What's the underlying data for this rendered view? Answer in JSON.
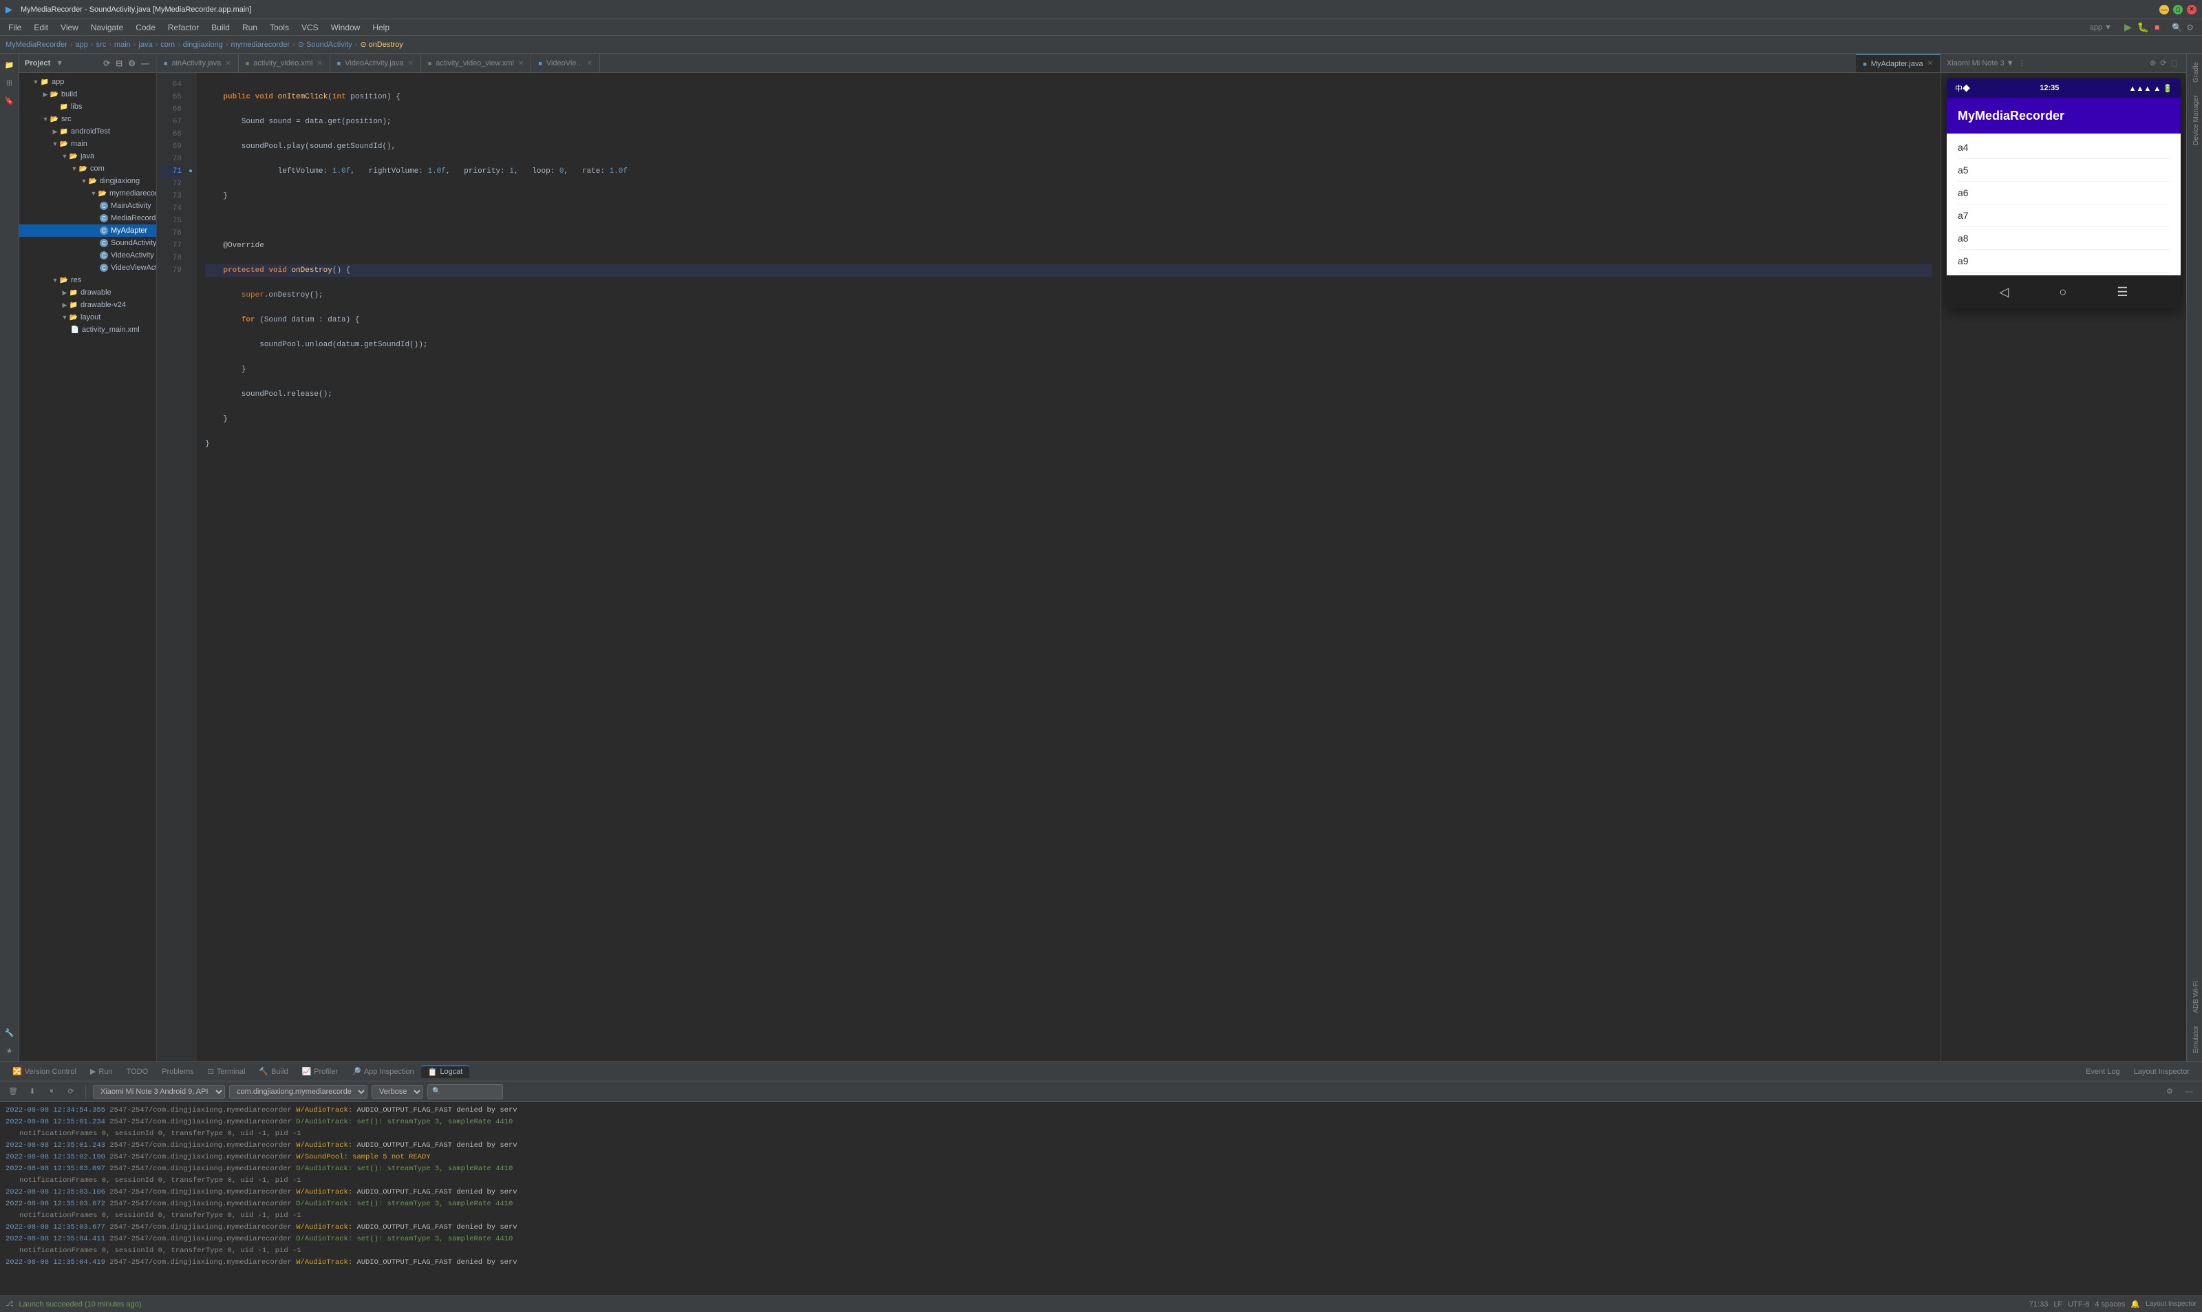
{
  "window": {
    "title": "MyMediaRecorder - SoundActivity.java [MyMediaRecorder.app.main]",
    "minimize_label": "—",
    "maximize_label": "□",
    "close_label": "✕"
  },
  "menu": {
    "items": [
      "File",
      "Edit",
      "View",
      "Navigate",
      "Code",
      "Refactor",
      "Build",
      "Run",
      "Tools",
      "VCS",
      "Window",
      "Help"
    ]
  },
  "breadcrumb": {
    "items": [
      "MyMediaRecorder",
      "app",
      "src",
      "main",
      "java",
      "com",
      "dingjiaxiong",
      "mymediarecorder",
      "SoundActivity",
      "onDestroy"
    ]
  },
  "project_panel": {
    "title": "Project",
    "tree": [
      {
        "label": "app",
        "type": "folder",
        "level": 0,
        "expanded": true
      },
      {
        "label": "build",
        "type": "folder",
        "level": 1,
        "expanded": true
      },
      {
        "label": "libs",
        "type": "folder",
        "level": 2
      },
      {
        "label": "src",
        "type": "folder",
        "level": 1,
        "expanded": true
      },
      {
        "label": "androidTest",
        "type": "folder",
        "level": 2
      },
      {
        "label": "main",
        "type": "folder",
        "level": 2,
        "expanded": true
      },
      {
        "label": "java",
        "type": "folder",
        "level": 3,
        "expanded": true
      },
      {
        "label": "com",
        "type": "folder",
        "level": 4,
        "expanded": true
      },
      {
        "label": "dingjiaxiong",
        "type": "folder",
        "level": 5,
        "expanded": true
      },
      {
        "label": "mymediarecorder",
        "type": "folder",
        "level": 6,
        "expanded": true
      },
      {
        "label": "MainActivity",
        "type": "java",
        "level": 7
      },
      {
        "label": "MediaRecordActivity",
        "type": "java",
        "level": 7
      },
      {
        "label": "MyAdapter",
        "type": "java",
        "level": 7,
        "selected": true
      },
      {
        "label": "SoundActivity",
        "type": "java",
        "level": 7
      },
      {
        "label": "VideoActivity",
        "type": "java",
        "level": 7
      },
      {
        "label": "VideoViewActivity",
        "type": "java",
        "level": 7
      },
      {
        "label": "res",
        "type": "folder",
        "level": 2,
        "expanded": true
      },
      {
        "label": "drawable",
        "type": "folder",
        "level": 3
      },
      {
        "label": "drawable-v24",
        "type": "folder",
        "level": 3
      },
      {
        "label": "layout",
        "type": "folder",
        "level": 3,
        "expanded": true
      },
      {
        "label": "activity_main.xml",
        "type": "xml",
        "level": 4
      }
    ]
  },
  "editor": {
    "tabs": [
      {
        "label": "ainActivity.java",
        "active": false
      },
      {
        "label": "activity_video.xml",
        "active": false
      },
      {
        "label": "VideoActivity.java",
        "active": false
      },
      {
        "label": "activity_video_view.xml",
        "active": false
      },
      {
        "label": "VideoVie...",
        "active": false
      }
    ],
    "right_tab": "MyAdapter.java",
    "lines": [
      {
        "num": 64,
        "content": "    <span class='kw'>public</span> <span class='kw'>void</span> <span class='method-name'>onItemClick</span>(<span class='kw'>int</span> position) {"
      },
      {
        "num": 65,
        "content": "        Sound sound = data.get(position);"
      },
      {
        "num": 66,
        "content": "        soundPool.play(sound.getSoundId(),"
      },
      {
        "num": 67,
        "content": "                leftVolume: <span class='number'>1.0f</span>,   rightVolume: <span class='number'>1.0f</span>,   priority: <span class='number'>1</span>,   loop: <span class='number'>0</span>,   rate: <span class='number'>1.0f</span>"
      },
      {
        "num": 68,
        "content": "    }"
      },
      {
        "num": 69,
        "content": ""
      },
      {
        "num": 70,
        "content": "    <span class='annotation'>@Override</span>"
      },
      {
        "num": 71,
        "content": "    <span class='kw'>protected</span> <span class='kw'>void</span> <span class='method-name'>onDestroy</span>() {"
      },
      {
        "num": 72,
        "content": "        super.onDestroy();"
      },
      {
        "num": 73,
        "content": "        <span class='kw'>for</span> (Sound datum : data) {"
      },
      {
        "num": 74,
        "content": "            soundPool.unload(datum.getSoundId());"
      },
      {
        "num": 75,
        "content": "        }"
      },
      {
        "num": 76,
        "content": "        soundPool.release();"
      },
      {
        "num": 77,
        "content": "    }"
      },
      {
        "num": 78,
        "content": "}"
      },
      {
        "num": 79,
        "content": ""
      }
    ]
  },
  "device": {
    "time": "12:35",
    "signal": "●●● ▲ WiFi 🔋",
    "app_title": "MyMediaRecorder",
    "list_items": [
      "a4",
      "a5",
      "a6",
      "a7",
      "a8",
      "a9"
    ]
  },
  "logcat": {
    "device": "Xiaomi Mi Note 3  Android 9, API",
    "package": "com.dingjiaxiong.mymediarecorde",
    "level": "Verbose",
    "logs": [
      {
        "type": "warn",
        "text": "2022-08-08  12:34:54.355  2547-2547/com.dingjiaxiong.mymediarecorder  W/AudioTrack:  AUDIO_OUTPUT_FLAG_FAST denied by serv"
      },
      {
        "type": "debug",
        "text": "2022-08-08  12:35:01.234  2547-2547/com.dingjiaxiong.mymediarecorder  D/AudioTrack:  set(): streamType 3, sampleRate 4410"
      },
      {
        "type": "continued",
        "text": "    notificationFrames 0, sessionId 0, transferType 0, uid -1, pid -1"
      },
      {
        "type": "warn",
        "text": "2022-08-08  12:35:01.243  2547-2547/com.dingjiaxiong.mymediarecorder  W/AudioTrack:  AUDIO_OUTPUT_FLAG_FAST denied by serv"
      },
      {
        "type": "warn",
        "text": "2022-08-08  12:35:02.190  2547-2547/com.dingjiaxiong.mymediarecorder  W/SoundPool:   sample 5 not READY"
      },
      {
        "type": "debug",
        "text": "2022-08-08  12:35:03.097  2547-2547/com.dingjiaxiong.mymediarecorder  D/AudioTrack:  set(): streamType 3, sampleRate 4410"
      },
      {
        "type": "continued",
        "text": "    notificationFrames 0, sessionId 0, transferType 0, uid -1, pid -1"
      },
      {
        "type": "warn",
        "text": "2022-08-08  12:35:03.106  2547-2547/com.dingjiaxiong.mymediarecorder  W/AudioTrack:  AUDIO_OUTPUT_FLAG_FAST denied by serv"
      },
      {
        "type": "debug",
        "text": "2022-08-08  12:35:03.672  2547-2547/com.dingjiaxiong.mymediarecorder  D/AudioTrack:  set(): streamType 3, sampleRate 4410"
      },
      {
        "type": "continued",
        "text": "    notificationFrames 0, sessionId 0, transferType 0, uid -1, pid -1"
      },
      {
        "type": "warn",
        "text": "2022-08-08  12:35:03.677  2547-2547/com.dingjiaxiong.mymediarecorder  W/AudioTrack:  AUDIO_OUTPUT_FLAG_FAST denied by serv"
      },
      {
        "type": "debug",
        "text": "2022-08-08  12:35:04.411  2547-2547/com.dingjiaxiong.mymediarecorder  D/AudioTrack:  set(): streamType 3, sampleRate 4410"
      },
      {
        "type": "continued",
        "text": "    notificationFrames 0, sessionId 0, transferType 0, uid -1, pid -1"
      },
      {
        "type": "warn",
        "text": "2022-08-08  12:35:04.419  2547-2547/com.dingjiaxiong.mymediarecorder  W/AudioTrack:  AUDIO_OUTPUT_FLAG_FAST denied by serv"
      }
    ]
  },
  "bottom_tabs": {
    "items": [
      "Version Control",
      "Run",
      "TODO",
      "Problems",
      "Terminal",
      "Build",
      "Profiler",
      "App Inspection",
      "Logcat"
    ],
    "active": "Logcat"
  },
  "status_bar": {
    "message": "Launch succeeded (10 minutes ago)",
    "position": "71:33",
    "encoding": "UTF-8",
    "indent": "4 spaces",
    "layout_inspector": "Layout Inspector"
  },
  "colors": {
    "accent": "#4a9ee5",
    "toolbar_bg": "#3c3f41",
    "editor_bg": "#2b2b2b",
    "device_bar": "#3700b3",
    "device_status": "#1a0a6e",
    "success": "#6a9955",
    "warn_text": "#ffc66d",
    "error_text": "#ff6b68"
  }
}
